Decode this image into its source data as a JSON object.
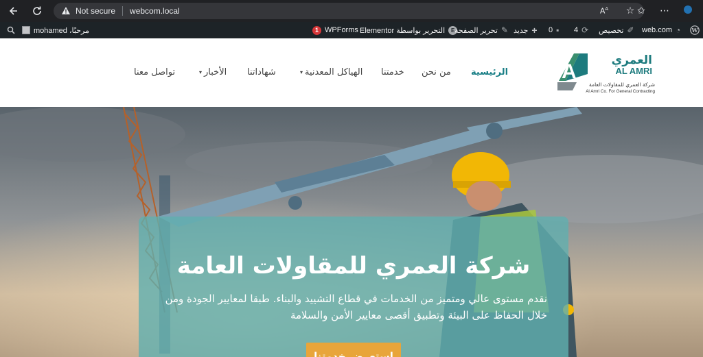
{
  "browser": {
    "security_label": "Not secure",
    "url": "webcom.local"
  },
  "admin_bar": {
    "site_name": "web.com",
    "customize": "تخصيص",
    "updates_count": "4",
    "comments_count": "0",
    "new_label": "جديد",
    "edit_page": "تحرير الصفحة",
    "edit_elementor": "التحرير بواسطة Elementor",
    "wpforms": "WPForms",
    "wpforms_badge": "1",
    "greeting": "مرحبًا، mohamed"
  },
  "header": {
    "logo": {
      "arabic": "العمري",
      "latin": "AL AMRI",
      "tagline_ar": "شركة العمري للمقاولات العامة",
      "tagline_en": "Al Amri Co. For General Contracting"
    },
    "nav": {
      "home": "الرئيسية",
      "about": "من نحن",
      "services": "خدمتنا",
      "steel": "الهياكل المعدنية",
      "certs": "شهاداتنا",
      "news": "الأخبار",
      "contact": "تواصل معنا"
    }
  },
  "hero": {
    "title": "شركة العمري للمقاولات العامة",
    "text": "نقدم مستوى عالي ومتميز من الخدمات في قطاع التشييد والبناء. طبقا لمعايير الجودة ومن خلال الحفاظ على البيئة وتطبيق أقصى معايير الأمن والسلامة",
    "button": "استعرض خدمتنا"
  },
  "colors": {
    "accent": "#1a7f86",
    "logo_dark": "#1d7b7e",
    "logo_green": "#3cb371",
    "button": "#e8a53a"
  }
}
